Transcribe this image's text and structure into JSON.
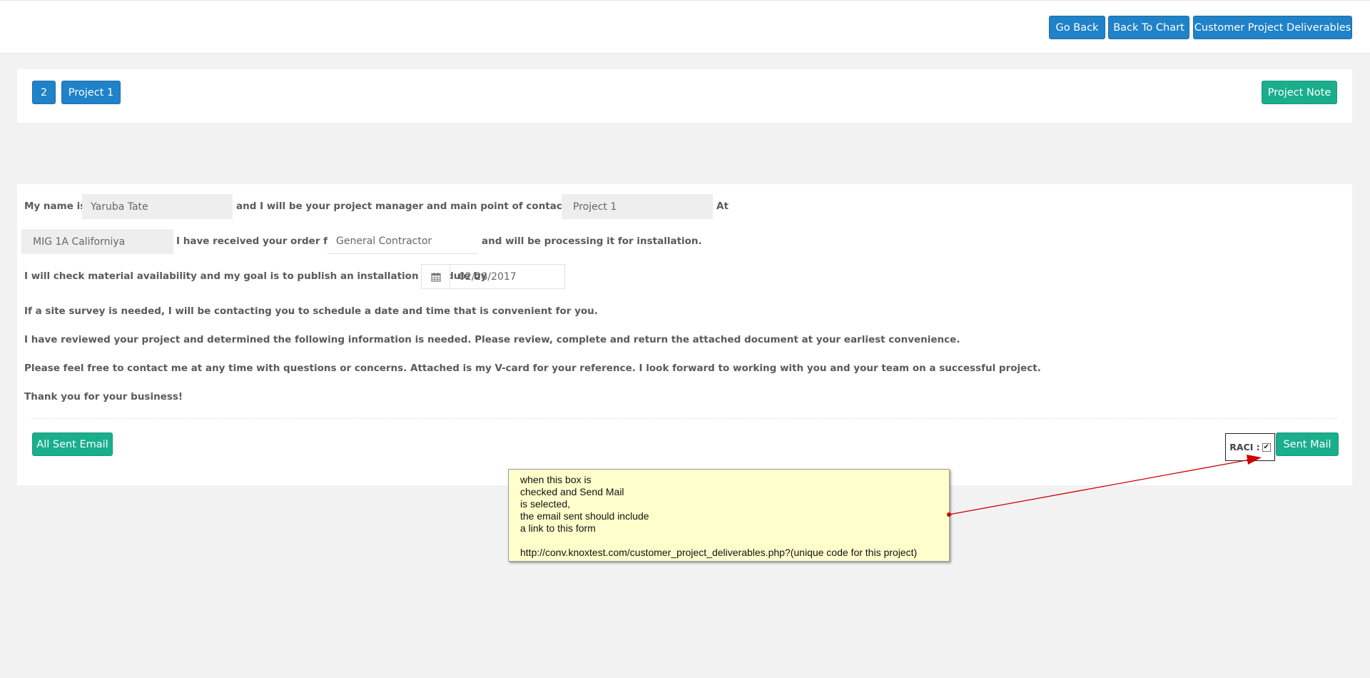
{
  "header": {
    "go_back": "Go Back",
    "back_to_chart": "Back To Chart",
    "customer_project_deliverables": "Customer Project Deliverables"
  },
  "project_bar": {
    "number": "2",
    "name": "Project 1",
    "project_note": "Project Note"
  },
  "letter": {
    "line1_pre": "My name is",
    "manager_name": "Yaruba Tate",
    "line1_mid": "and I will be your project manager and main point of contact for your",
    "project_name": "Project 1",
    "line1_post": "At",
    "location": "MIG 1A Californiya",
    "line2_mid": "I have received your order from",
    "contractor": "General Contractor",
    "line2_post": "and will be processing it for installation.",
    "line3": "I will check material availability and my goal is to publish an installation schedule by",
    "schedule_date": "02/28/2017",
    "para1": "If a site survey is needed, I will be contacting you to schedule a date and time that is convenient for you.",
    "para2": "I have reviewed your project and determined the following information is needed. Please review, complete and return the attached document at your earliest convenience.",
    "para3": "Please feel free to contact me at any time with questions or concerns. Attached is my V-card for your reference. I look forward to working with you and your team on a successful project.",
    "para4": "Thank you for your business!"
  },
  "footer": {
    "all_sent_email": "All Sent Email",
    "raci_label": "RACI :",
    "raci_checked": true,
    "sent_mail": "Sent Mail"
  },
  "annotation": {
    "lines": [
      "when this box is",
      "checked and Send Mail",
      "is selected,",
      "the email sent should include",
      "a link to this form",
      "",
      "http://conv.knoxtest.com/customer_project_deliverables.php?(unique code for this project)"
    ]
  },
  "icons": {
    "date": "calendar-icon",
    "raci_checkbox": "checkbox-checked-icon",
    "annotation_arrow": "arrow-icon"
  },
  "colors": {
    "primary": "#2082c8",
    "success": "#1aae8c",
    "note_bg": "#ffffcc",
    "arrow": "#cc0000"
  }
}
